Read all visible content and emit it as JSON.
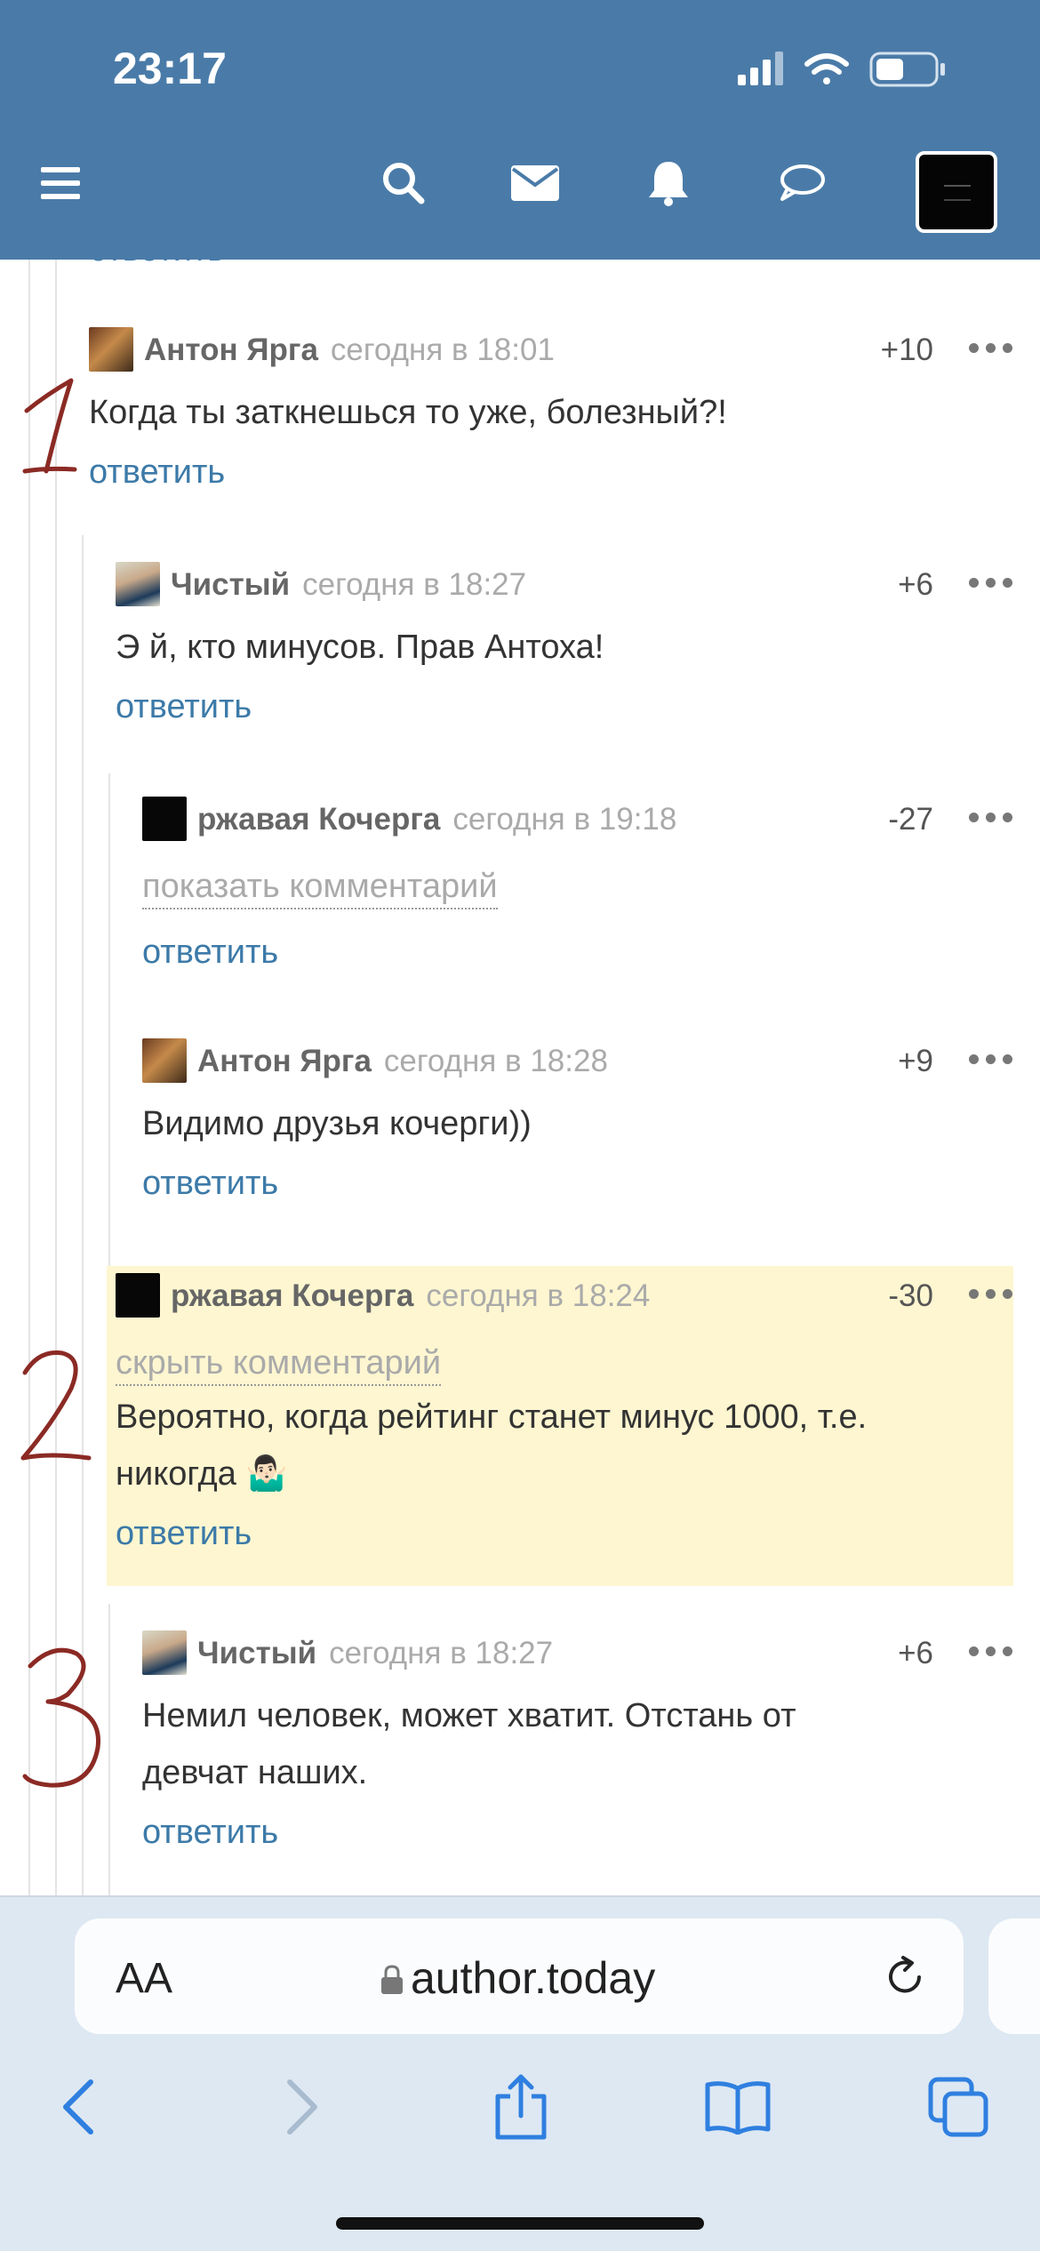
{
  "status_bar": {
    "time": "23:17"
  },
  "header": {
    "icons": [
      "menu-icon",
      "search-icon",
      "mail-icon",
      "bell-icon",
      "chat-icon"
    ]
  },
  "partial_reply_label": "ответить",
  "comments": [
    {
      "author": "Антон Ярга",
      "date": "сегодня в 18:01",
      "rating": "+10",
      "text": "Когда ты заткнешься то уже, болезный?!",
      "reply": "ответить"
    },
    {
      "author": "Чистый",
      "date": "сегодня в 18:27",
      "rating": "+6",
      "text": "Э й, кто минусов. Прав Антоха!",
      "reply": "ответить"
    },
    {
      "author": "ржавая Кочерга",
      "date": "сегодня в 19:18",
      "rating": "-27",
      "toggle": "показать комментарий",
      "reply": "ответить"
    },
    {
      "author": "Антон Ярга",
      "date": "сегодня в 18:28",
      "rating": "+9",
      "text": "Видимо друзья кочерги))",
      "reply": "ответить"
    },
    {
      "author": "ржавая Кочерга",
      "date": "сегодня в 18:24",
      "rating": "-30",
      "toggle": "скрыть комментарий",
      "text_line1": "Вероятно, когда рейтинг станет минус 1000, т.е.",
      "text_line2": "никогда 🤷🏻‍♂️",
      "reply": "ответить"
    },
    {
      "author": "Чистый",
      "date": "сегодня в 18:27",
      "rating": "+6",
      "text_line1": "Немил человек, может хватит. Отстань от",
      "text_line2": "девчат наших.",
      "reply": "ответить"
    }
  ],
  "annotations": [
    "1",
    "2",
    "3"
  ],
  "safari": {
    "text_size_label": "AA",
    "url": "author.today"
  },
  "colors": {
    "header": "#4a7ba8",
    "link": "#3c7aa8",
    "highlight": "#fdf6d0",
    "annotation": "#8b2a24"
  }
}
